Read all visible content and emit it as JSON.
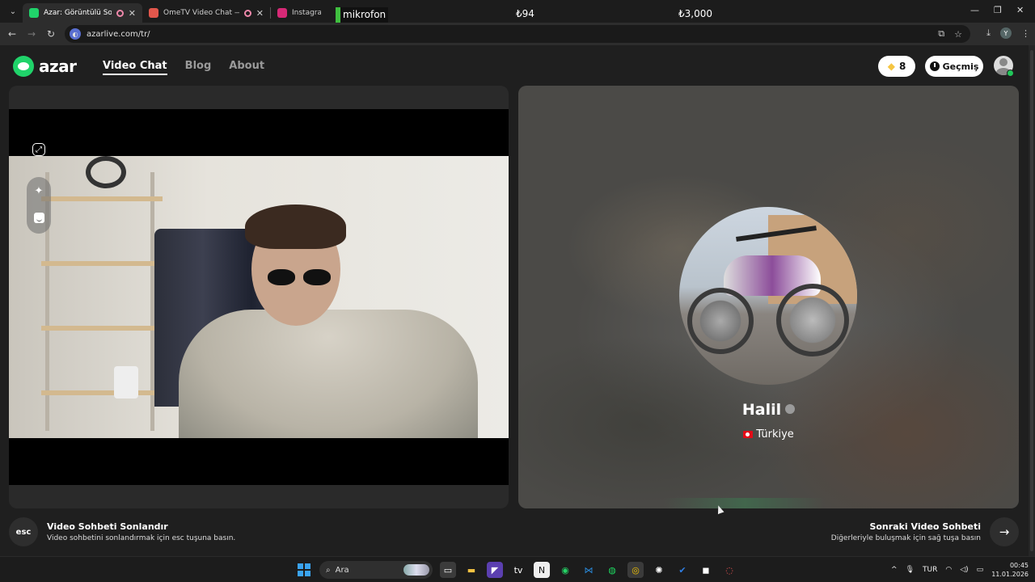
{
  "browser": {
    "tabs": [
      {
        "title": "Azar: Görüntülü Sohbet & V",
        "active": true,
        "favicon_color": "#20d36a"
      },
      {
        "title": "OmeTV Video Chat — Ome",
        "active": false,
        "favicon_color": "#e2574c"
      },
      {
        "title": "Instagram",
        "active": false,
        "favicon_color": "#d62976"
      }
    ],
    "overlay": {
      "mic_label": "mikrofon",
      "price_a": "₺94",
      "price_b": "₺3,000"
    },
    "url": "azarlive.com/tr/"
  },
  "header": {
    "logo_text": "azar",
    "nav": [
      {
        "label": "Video Chat",
        "active": true
      },
      {
        "label": "Blog",
        "active": false
      },
      {
        "label": "About",
        "active": false
      }
    ],
    "gems_count": "8",
    "history_label": "Geçmiş"
  },
  "remote_profile": {
    "name": "Halil",
    "country": "Türkiye"
  },
  "footer": {
    "end": {
      "key": "esc",
      "title": "Video Sohbeti Sonlandır",
      "subtitle": "Video sohbetini sonlandırmak için esc tuşuna basın."
    },
    "next": {
      "title": "Sonraki Video Sohbeti",
      "subtitle": "Diğerleriyle buluşmak için sağ tuşa basın"
    }
  },
  "taskbar": {
    "search_placeholder": "Ara",
    "language": "TUR",
    "time": "00:45",
    "date": "11.01.2026"
  },
  "colors": {
    "brand": "#20d36a",
    "gem": "#f5c542"
  }
}
